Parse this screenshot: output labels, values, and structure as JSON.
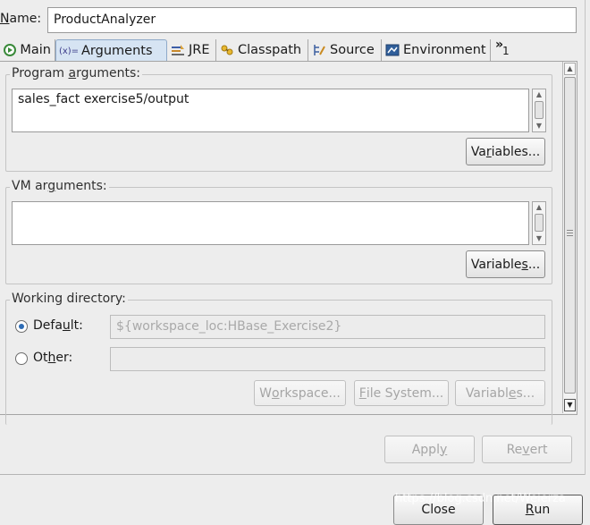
{
  "name_row": {
    "label": "Name:",
    "value": "ProductAnalyzer"
  },
  "tabs": [
    {
      "label": "Main",
      "icon": "main-run-icon"
    },
    {
      "label": "Arguments",
      "icon": "arguments-icon"
    },
    {
      "label": "JRE",
      "icon": "jre-icon"
    },
    {
      "label": "Classpath",
      "icon": "classpath-icon"
    },
    {
      "label": "Source",
      "icon": "source-icon"
    },
    {
      "label": "Environment",
      "icon": "environment-icon"
    }
  ],
  "tab_overflow": {
    "glyph": "»",
    "count": "1"
  },
  "program_arguments": {
    "title": "Program arguments:",
    "value": "sales_fact exercise5/output",
    "variables_button": "Variables..."
  },
  "vm_arguments": {
    "title": "VM arguments:",
    "value": "",
    "variables_button": "Variables..."
  },
  "working_directory": {
    "title": "Working directory:",
    "default_label": "Default:",
    "default_value": "${workspace_loc:HBase_Exercise2}",
    "other_label": "Other:",
    "other_value": "",
    "workspace_button": "Workspace...",
    "filesystem_button": "File System...",
    "variables_button": "Variables..."
  },
  "actions": {
    "apply": "Apply",
    "revert": "Revert"
  },
  "dialog_buttons": {
    "close": "Close",
    "run": "Run"
  },
  "watermark": "https://blog.csdn.net/Weierza",
  "colors": {
    "accent": "#2e6cb5",
    "active_tab": "#d6e4f3",
    "background": "#ededed"
  }
}
